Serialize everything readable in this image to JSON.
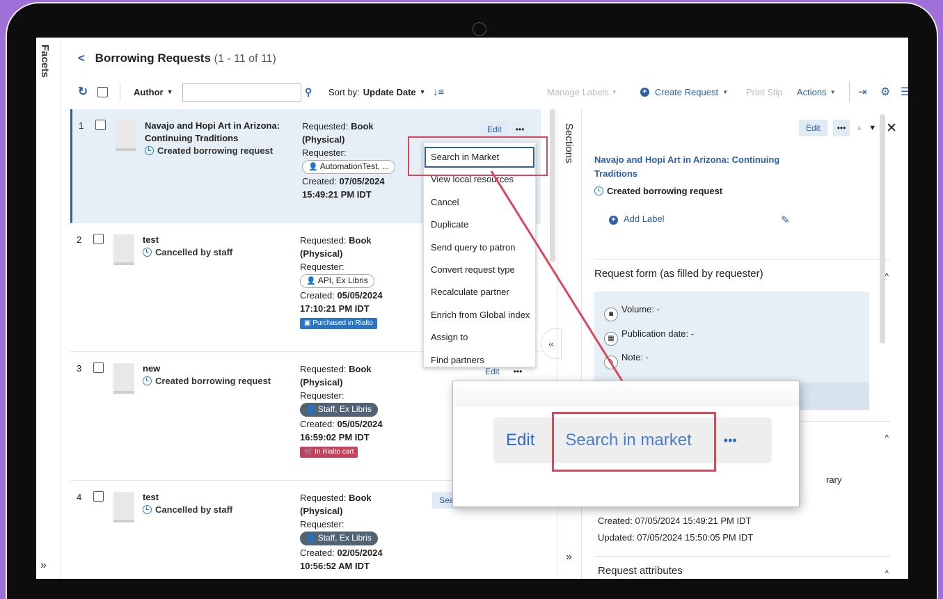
{
  "facets": {
    "label": "Facets",
    "expand": "»"
  },
  "header": {
    "back": "<",
    "title": "Borrowing Requests",
    "count": "(1 - 11 of 11)"
  },
  "toolbar": {
    "filter_field": "Author",
    "sort_label": "Sort by:",
    "sort_value": "Update Date",
    "manage_labels": "Manage Labels",
    "create_request": "Create Request",
    "print_slip": "Print Slip",
    "actions": "Actions"
  },
  "rows": [
    {
      "num": "1",
      "title": "Navajo and Hopi Art in Arizona: Continuing Traditions",
      "status": "Created borrowing request",
      "requested_label": "Requested:",
      "format": "Book",
      "format2": "(Physical)",
      "requester_label": "Requester:",
      "requester": "AutomationTest, ...",
      "created_label": "Created:",
      "created": "07/05/2024",
      "time": "15:49:21 PM IDT",
      "edit": "Edit",
      "more": "•••"
    },
    {
      "num": "2",
      "title": "test",
      "status": "Cancelled by staff",
      "requested_label": "Requested:",
      "format": "Book",
      "format2": "(Physical)",
      "requester_label": "Requester:",
      "requester": "API, Ex Libris",
      "created_label": "Created:",
      "created": "05/05/2024",
      "time": "17:10:21 PM IDT",
      "badge": "Purchased in Rialto"
    },
    {
      "num": "3",
      "title": "new",
      "status": "Created borrowing request",
      "requested_label": "Requested:",
      "format": "Book",
      "format2": "(Physical)",
      "requester_label": "Requester:",
      "requester": "Staff, Ex Libris",
      "created_label": "Created:",
      "created": "05/05/2024",
      "time": "16:59:02 PM IDT",
      "badge": "In Rialto cart",
      "edit": "Edit",
      "more": "•••"
    },
    {
      "num": "4",
      "title": "test",
      "status": "Cancelled by staff",
      "requested_label": "Requested:",
      "format": "Book",
      "format2": "(Physical)",
      "requester_label": "Requester:",
      "requester": "Staff, Ex Libris",
      "created_label": "Created:",
      "created": "02/05/2024",
      "time": "10:56:52 AM IDT",
      "search_partial": "Sea"
    }
  ],
  "menu": {
    "items": [
      "Search in Market",
      "View local resources",
      "Cancel",
      "Duplicate",
      "Send query to patron",
      "Convert request type",
      "Recalculate partner",
      "Enrich from Global index",
      "Assign to",
      "Find partners"
    ]
  },
  "sections": {
    "label": "Sections",
    "expand": "»",
    "collapse": "«"
  },
  "detail": {
    "edit": "Edit",
    "more": "•••",
    "close": "✕",
    "title": "Navajo and Hopi Art in Arizona: Continuing Traditions",
    "status": "Created borrowing request",
    "add_label": "Add Label",
    "request_form_title": "Request form (as filled by requester)",
    "fields": [
      {
        "label": "Volume:",
        "value": "-"
      },
      {
        "label": "Publication date:",
        "value": "-"
      },
      {
        "label": "Note:",
        "value": "-"
      }
    ],
    "partial_text": "rary",
    "created": "Created: 07/05/2024 15:49:21 PM IDT",
    "updated": "Updated: 07/05/2024 15:50:05 PM IDT",
    "attributes_title": "Request attributes"
  },
  "zoom": {
    "edit": "Edit",
    "search": "Search in market",
    "more": "•••"
  },
  "colors": {
    "accent": "#2b5fa8",
    "highlight": "#d9475a",
    "frame_bg": "#a06fd8"
  }
}
